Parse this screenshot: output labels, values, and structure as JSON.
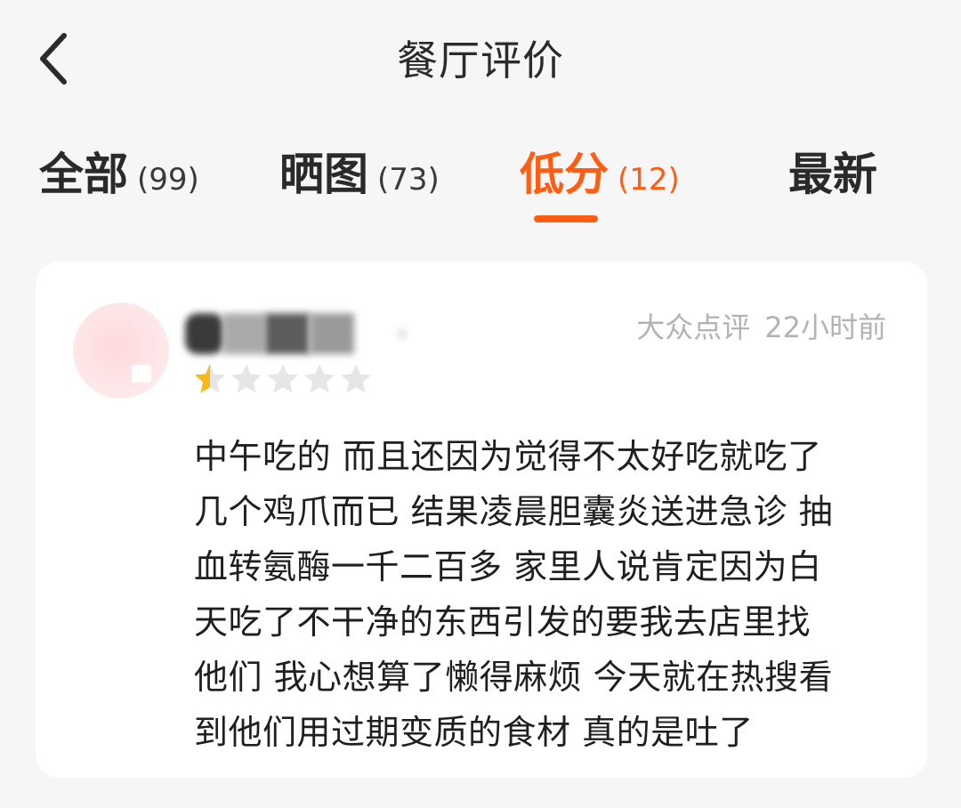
{
  "header": {
    "title": "餐厅评价",
    "back_icon": "chevron-left-icon"
  },
  "tabs": [
    {
      "label": "全部",
      "count": "(99)",
      "active": false
    },
    {
      "label": "晒图",
      "count": "(73)",
      "active": false
    },
    {
      "label": "低分",
      "count": "(12)",
      "active": true
    },
    {
      "label": "最新",
      "count": "",
      "active": false
    }
  ],
  "colors": {
    "accent": "#ff5d12",
    "star_filled": "#f5b91a",
    "star_empty": "#e6e6e6",
    "meta_text": "#b3b3b3"
  },
  "review": {
    "source": "大众点评",
    "time": "22小时前",
    "rating": 0.5,
    "rating_max": 5,
    "lines": [
      "中午吃的 而且还因为觉得不太好吃就吃了",
      "几个鸡爪而已 结果凌晨胆囊炎送进急诊 抽",
      "血转氨酶一千二百多 家里人说肯定因为白",
      "天吃了不干净的东西引发的要我去店里找",
      "他们 我心想算了懒得麻烦 今天就在热搜看",
      "到他们用过期变质的食材 真的是吐了"
    ]
  }
}
